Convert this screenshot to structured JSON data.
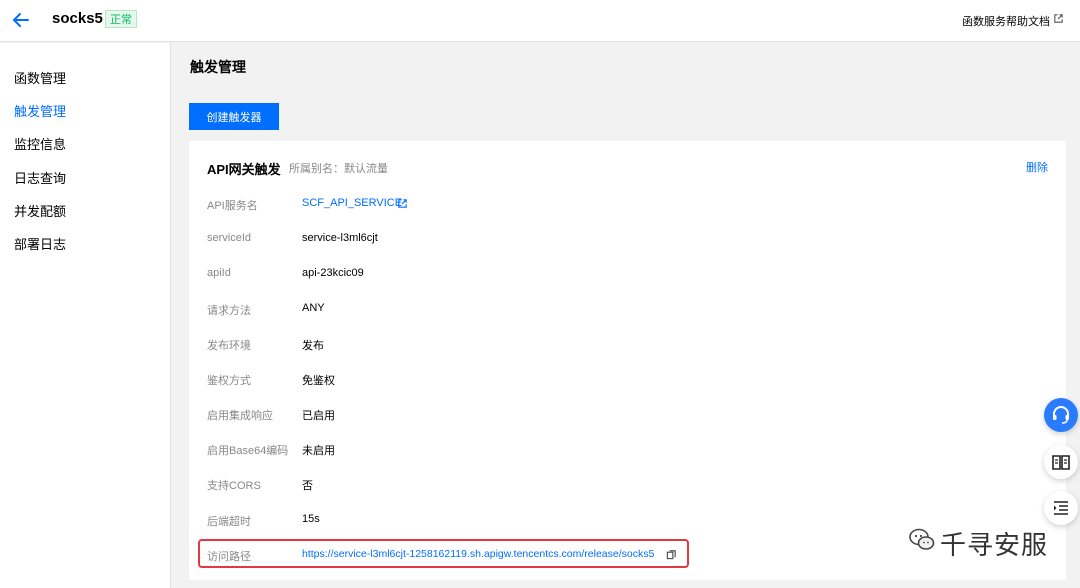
{
  "header": {
    "title": "socks5",
    "status": "正常",
    "help_link": "函数服务帮助文档"
  },
  "sidebar": {
    "items": [
      {
        "label": "函数管理"
      },
      {
        "label": "触发管理",
        "active": true
      },
      {
        "label": "监控信息"
      },
      {
        "label": "日志查询"
      },
      {
        "label": "并发配额"
      },
      {
        "label": "部署日志"
      }
    ]
  },
  "main": {
    "page_title": "触发管理",
    "create_button": "创建触发器",
    "trigger": {
      "title": "API网关触发",
      "alias": "所属别名：默认流量",
      "delete": "删除",
      "fields": [
        {
          "label": "API服务名",
          "value": "SCF_API_SERVICE"
        },
        {
          "label": "serviceId",
          "value": "service-l3ml6cjt"
        },
        {
          "label": "apiId",
          "value": "api-23kcic09"
        },
        {
          "label": "请求方法",
          "value": "ANY"
        },
        {
          "label": "发布环境",
          "value": "发布"
        },
        {
          "label": "鉴权方式",
          "value": "免鉴权"
        },
        {
          "label": "启用集成响应",
          "value": "已启用"
        },
        {
          "label": "启用Base64编码",
          "value": "未启用"
        },
        {
          "label": "支持CORS",
          "value": "否"
        },
        {
          "label": "后端超时",
          "value": "15s"
        },
        {
          "label": "访问路径",
          "value": "https://service-l3ml6cjt-1258162119.sh.apigw.tencentcs.com/release/socks5"
        }
      ]
    }
  },
  "watermark": {
    "text": "千寻安服"
  },
  "colors": {
    "accent": "#006eff",
    "status_green": "#0abf5b",
    "highlight_red": "#e0393e"
  },
  "icons": [
    "back-arrow-icon",
    "external-link-icon",
    "copy-icon",
    "headset-icon",
    "book-icon",
    "list-icon",
    "wechat-icon"
  ]
}
